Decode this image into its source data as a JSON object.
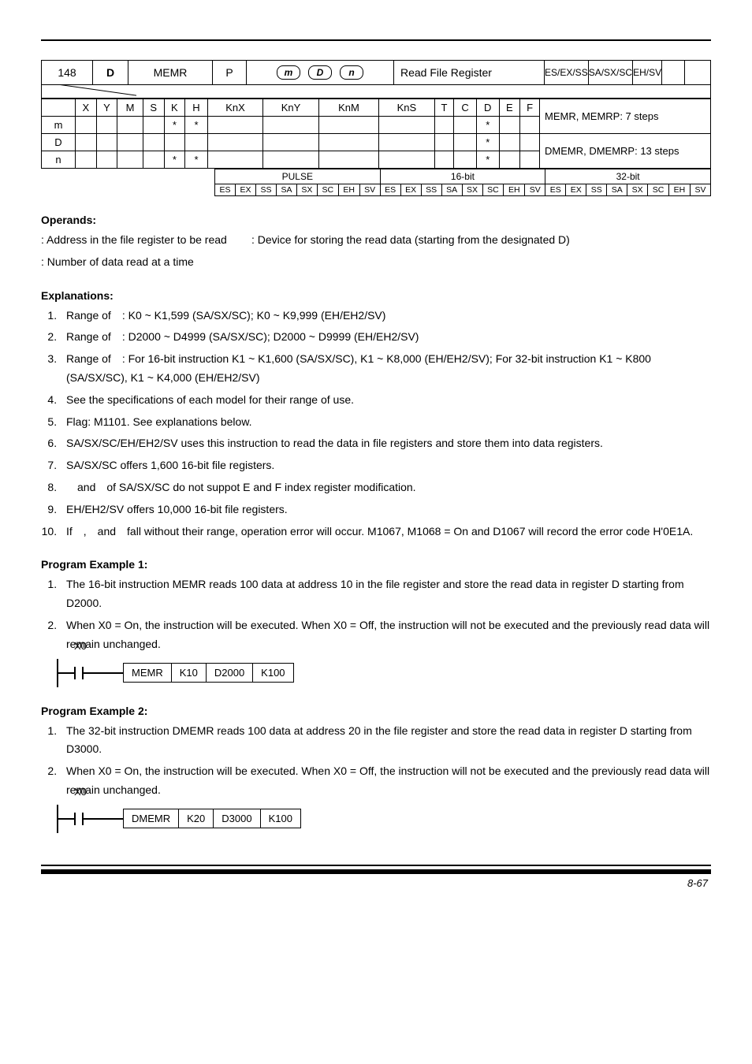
{
  "api": {
    "num": "148",
    "dflag": "D",
    "name": "MEMR",
    "p": "P",
    "op_m": "m",
    "op_D": "D",
    "op_n": "n",
    "desc": "Read File Register",
    "ctrl": [
      "ES/EX/SS",
      "SA/SX/SC",
      "EH/SV"
    ]
  },
  "optable": {
    "cols": [
      "X",
      "Y",
      "M",
      "S",
      "K",
      "H",
      "KnX",
      "KnY",
      "KnM",
      "KnS",
      "T",
      "C",
      "D",
      "E",
      "F",
      ""
    ],
    "rows": [
      {
        "label": "m",
        "cells": [
          "",
          "",
          "",
          "",
          "*",
          "*",
          "",
          "",
          "",
          "",
          "",
          "",
          "*",
          "",
          "",
          "MEMR, MEMRP: 7 steps"
        ]
      },
      {
        "label": "D",
        "cells": [
          "",
          "",
          "",
          "",
          "",
          "",
          "",
          "",
          "",
          "",
          "",
          "",
          "*",
          "",
          "",
          "DMEMR, DMEMRP: 13 steps"
        ]
      },
      {
        "label": "n",
        "cells": [
          "",
          "",
          "",
          "",
          "*",
          "*",
          "",
          "",
          "",
          "",
          "",
          "",
          "*",
          "",
          "",
          ""
        ]
      }
    ],
    "span_note_top": "MEMR, MEMRP: 7 steps",
    "span_note_bottom": "DMEMR, DMEMRP: 13 steps"
  },
  "pulse": {
    "headers": [
      "PULSE",
      "16-bit",
      "32-bit"
    ],
    "cells": [
      "ES",
      "EX",
      "SS",
      "SA",
      "SX",
      "SC",
      "EH",
      "SV",
      "ES",
      "EX",
      "SS",
      "SA",
      "SX",
      "SC",
      "EH",
      "SV",
      "ES",
      "EX",
      "SS",
      "SA",
      "SX",
      "SC",
      "EH",
      "SV"
    ]
  },
  "operands": {
    "heading": "Operands:",
    "line1a": ": Address in the file register to be read",
    "line1b": ": Device for storing the read data (starting from the designated D)",
    "line2": ": Number of data read at a time"
  },
  "explanations": {
    "heading": "Explanations:",
    "items": [
      "Range of : K0 ~ K1,599 (SA/SX/SC); K0 ~ K9,999 (EH/EH2/SV)",
      "Range of : D2000 ~ D4999 (SA/SX/SC); D2000 ~ D9999 (EH/EH2/SV)",
      "Range of : For 16-bit instruction K1 ~ K1,600 (SA/SX/SC), K1 ~ K8,000 (EH/EH2/SV); For 32-bit instruction K1 ~ K800 (SA/SX/SC), K1 ~ K4,000 (EH/EH2/SV)",
      "See the specifications of each model for their range of use.",
      "Flag: M1101. See explanations below.",
      "SA/SX/SC/EH/EH2/SV uses this instruction to read the data in file registers and store them into data registers.",
      "SA/SX/SC offers 1,600 16-bit file registers.",
      " and of SA/SX/SC do not suppot E and F index register modification.",
      "EH/EH2/SV offers 10,000 16-bit file registers.",
      "If , and fall without their range, operation error will occur. M1067, M1068 = On and D1067 will record the error code H'0E1A."
    ]
  },
  "pe1": {
    "heading": "Program Example 1:",
    "items": [
      "The 16-bit instruction MEMR reads 100 data at address 10 in the file register and store the read data in register D starting from D2000.",
      "When X0 = On, the instruction will be executed. When X0 = Off, the instruction will not be executed and the previously read data will remain unchanged."
    ],
    "ladder": {
      "x": "X0",
      "inst": "MEMR",
      "p1": "K10",
      "p2": "D2000",
      "p3": "K100"
    }
  },
  "pe2": {
    "heading": "Program Example 2:",
    "items": [
      "The 32-bit instruction DMEMR reads 100 data at address 20 in the file register and store the read data in register D starting from D3000.",
      "When X0 = On, the instruction will be executed. When X0 = Off, the instruction will not be executed and the previously read data will remain unchanged."
    ],
    "ladder": {
      "x": "X0",
      "inst": "DMEMR",
      "p1": "K20",
      "p2": "D3000",
      "p3": "K100"
    }
  },
  "footer": {
    "page": "8-67"
  }
}
